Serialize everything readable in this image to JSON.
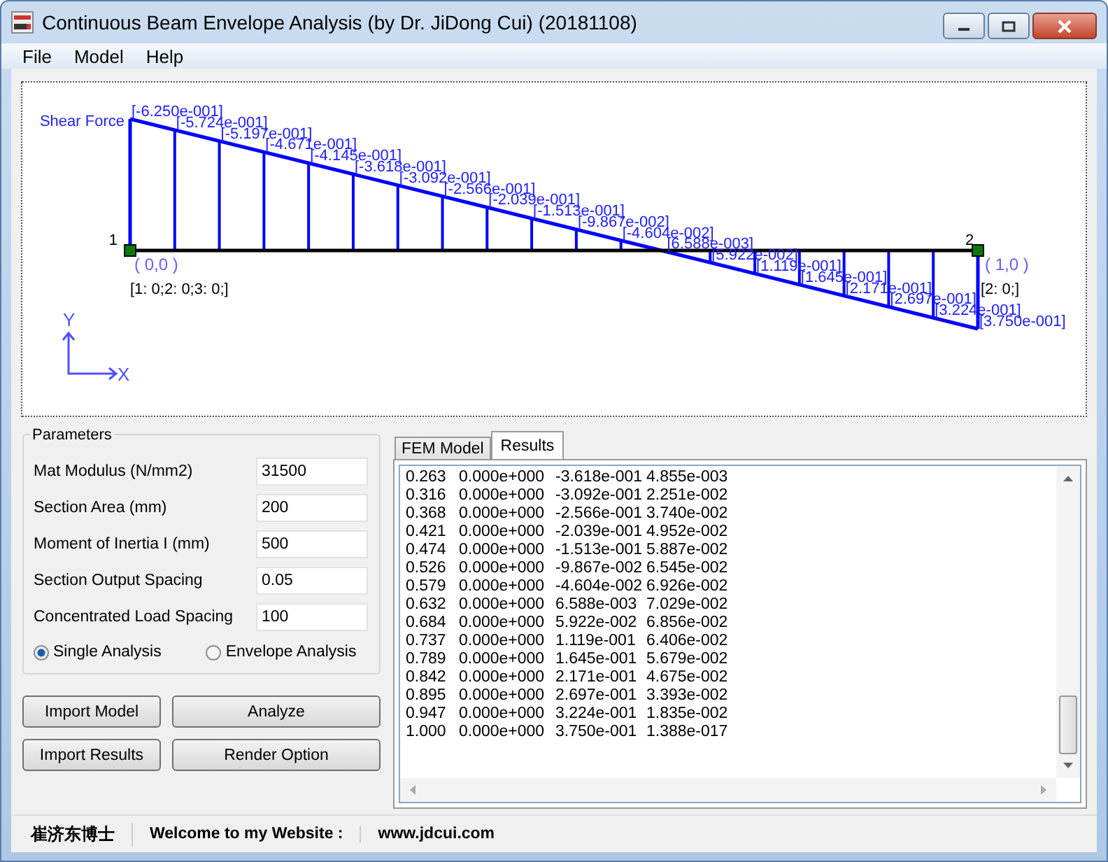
{
  "window": {
    "title": "Continuous Beam Envelope Analysis (by Dr. JiDong Cui) (20181108)"
  },
  "menu": [
    "File",
    "Model",
    "Help"
  ],
  "diagram": {
    "title": "Shear Force",
    "axis_x": "X",
    "axis_y": "Y",
    "stations": [
      "[-6.250e-001]",
      "[-5.724e-001]",
      "[-5.197e-001]",
      "[-4.671e-001]",
      "[-4.145e-001]",
      "[-3.618e-001]",
      "[-3.092e-001]",
      "[-2.566e-001]",
      "[-2.039e-001]",
      "[-1.513e-001]",
      "[-9.867e-002]",
      "[-4.604e-002]",
      "[6.588e-003]",
      "[5.922e-002]",
      "[1.119e-001]",
      "[1.645e-001]",
      "[2.171e-001]",
      "[2.697e-001]",
      "[3.224e-001]",
      "[3.750e-001]"
    ],
    "nodes": [
      {
        "number": "1",
        "coords": "( 0,0 )",
        "loads": "[1: 0;2: 0;3: 0;]"
      },
      {
        "number": "2",
        "coords": "( 1,0 )",
        "loads": "[2: 0;]"
      }
    ]
  },
  "parameters": {
    "title": "Parameters",
    "fields": [
      {
        "label": "Mat Modulus (N/mm2)",
        "value": "31500"
      },
      {
        "label": "Section Area  (mm)",
        "value": "200"
      },
      {
        "label": "Moment of Inertia I (mm)",
        "value": "500"
      },
      {
        "label": "Section Output Spacing",
        "value": "0.05"
      },
      {
        "label": "Concentrated Load Spacing",
        "value": "100"
      }
    ],
    "options": [
      {
        "label": "Single Analysis",
        "selected": true
      },
      {
        "label": "Envelope Analysis",
        "selected": false
      }
    ]
  },
  "buttons": [
    "Import Model",
    "Analyze",
    "Import Results",
    "Render Option"
  ],
  "tabs": [
    {
      "label": "FEM Model",
      "selected": false
    },
    {
      "label": "Results",
      "selected": true
    }
  ],
  "results": {
    "rows": [
      [
        "0.263",
        "0.000e+000",
        "-3.618e-001",
        "4.855e-003"
      ],
      [
        "0.316",
        "0.000e+000",
        "-3.092e-001",
        "2.251e-002"
      ],
      [
        "0.368",
        "0.000e+000",
        "-2.566e-001",
        "3.740e-002"
      ],
      [
        "0.421",
        "0.000e+000",
        "-2.039e-001",
        "4.952e-002"
      ],
      [
        "0.474",
        "0.000e+000",
        "-1.513e-001",
        "5.887e-002"
      ],
      [
        "0.526",
        "0.000e+000",
        "-9.867e-002",
        "6.545e-002"
      ],
      [
        "0.579",
        "0.000e+000",
        "-4.604e-002",
        "6.926e-002"
      ],
      [
        "0.632",
        "0.000e+000",
        "6.588e-003",
        "7.029e-002"
      ],
      [
        "0.684",
        "0.000e+000",
        "5.922e-002",
        "6.856e-002"
      ],
      [
        "0.737",
        "0.000e+000",
        "1.119e-001",
        "6.406e-002"
      ],
      [
        "0.789",
        "0.000e+000",
        "1.645e-001",
        "5.679e-002"
      ],
      [
        "0.842",
        "0.000e+000",
        "2.171e-001",
        "4.675e-002"
      ],
      [
        "0.895",
        "0.000e+000",
        "2.697e-001",
        "3.393e-002"
      ],
      [
        "0.947",
        "0.000e+000",
        "3.224e-001",
        "1.835e-002"
      ],
      [
        "1.000",
        "0.000e+000",
        "3.750e-001",
        "1.388e-017"
      ]
    ]
  },
  "status_bar": [
    "崔济东博士",
    "Welcome to my Website :",
    "www.jdcui.com"
  ]
}
